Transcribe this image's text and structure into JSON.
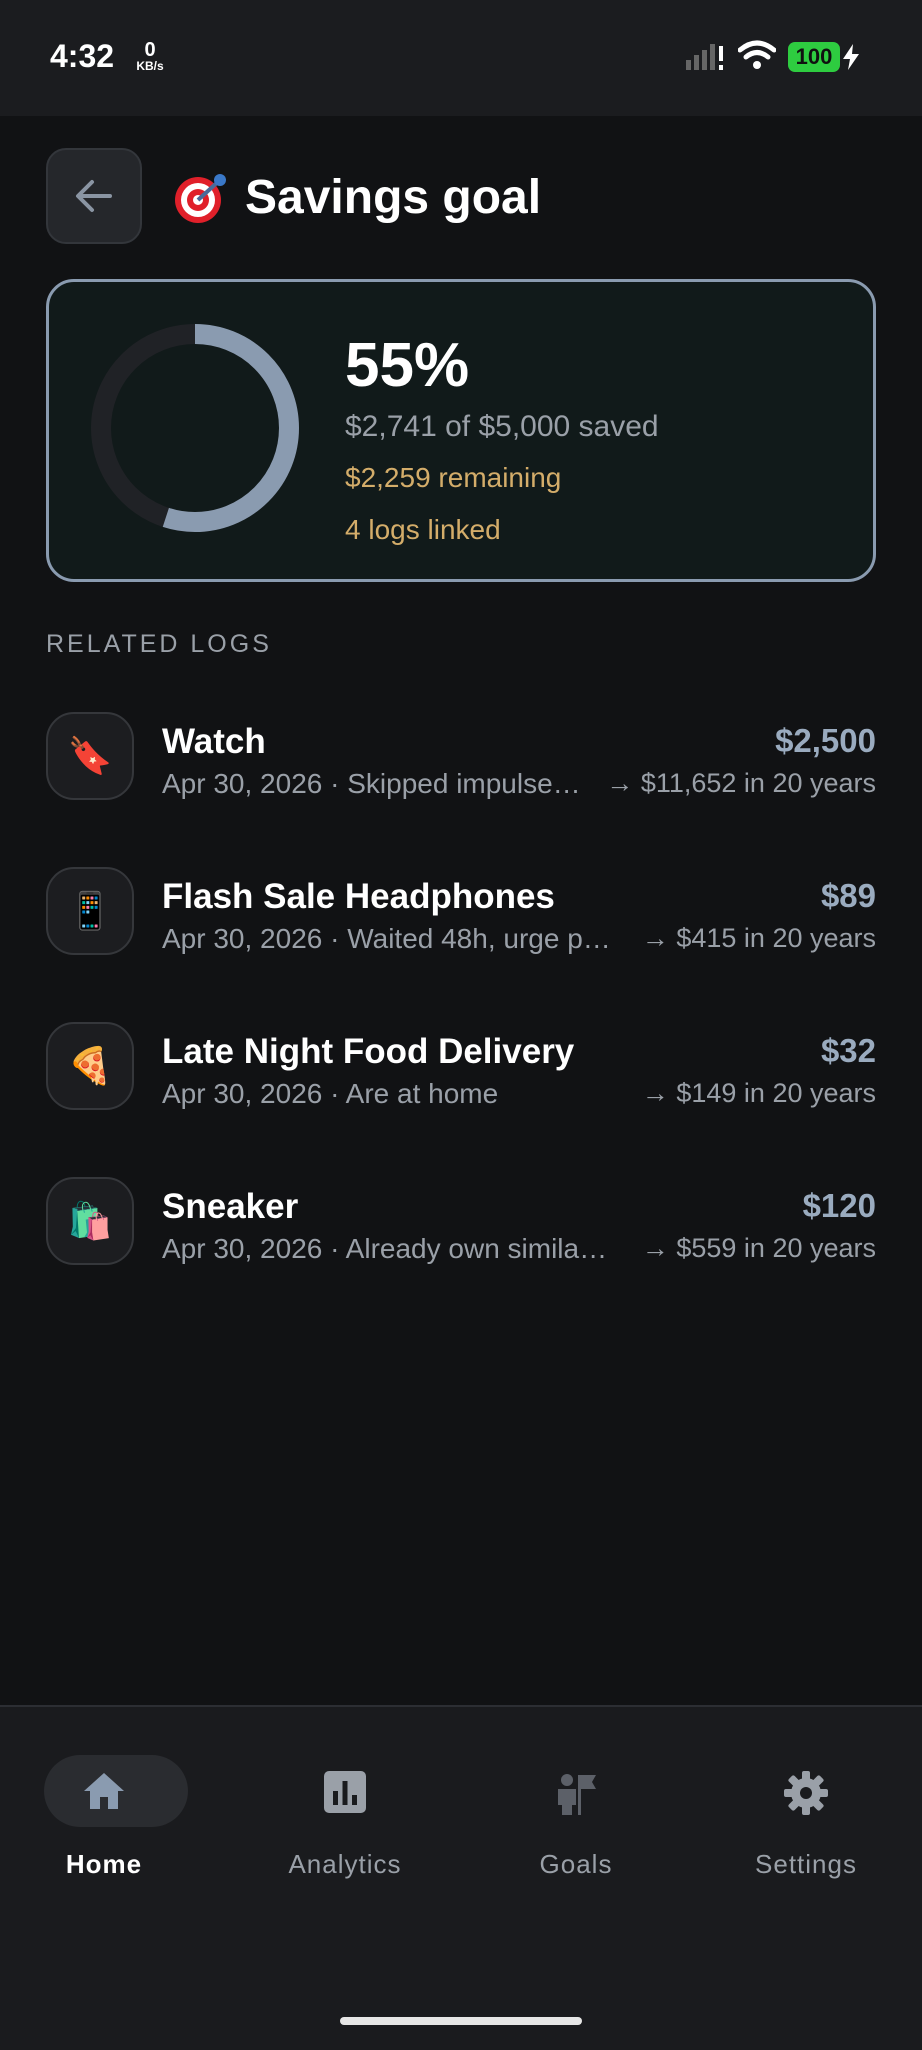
{
  "status": {
    "time": "4:32",
    "net_value": "0",
    "net_unit": "KB/s",
    "battery": "100"
  },
  "header": {
    "title": "Savings goal"
  },
  "goal": {
    "percent": "55%",
    "progress_fraction": 0.55,
    "saved_text": "$2,741 of $5,000 saved",
    "remaining_text": "$2,259 remaining",
    "logs_linked_text": "4 logs linked"
  },
  "section_label": "RELATED LOGS",
  "logs": [
    {
      "icon": "🔖",
      "icon_name": "tag-icon",
      "title": "Watch",
      "subtitle": "Apr 30, 2026  · Skipped impulse…",
      "amount": "$2,500",
      "projection": "→ $11,652 in 20 years"
    },
    {
      "icon": "📱",
      "icon_name": "phone-icon",
      "title": "Flash Sale Headphones",
      "subtitle": "Apr 30, 2026  · Waited 48h, urge p…",
      "amount": "$89",
      "projection": "→ $415 in 20 years"
    },
    {
      "icon": "🍕",
      "icon_name": "pizza-icon",
      "title": "Late Night Food Delivery",
      "subtitle": "Apr 30, 2026  · Are at home",
      "amount": "$32",
      "projection": "→ $149 in 20 years"
    },
    {
      "icon": "🛍️",
      "icon_name": "shopping-bags-icon",
      "title": "Sneaker",
      "subtitle": "Apr 30, 2026  · Already own simila…",
      "amount": "$120",
      "projection": "→ $559 in 20 years"
    }
  ],
  "nav": [
    {
      "label": "Home",
      "active": true,
      "icon": "home-icon"
    },
    {
      "label": "Analytics",
      "active": false,
      "icon": "analytics-icon"
    },
    {
      "label": "Goals",
      "active": false,
      "icon": "goals-icon"
    },
    {
      "label": "Settings",
      "active": false,
      "icon": "gear-icon"
    }
  ],
  "colors": {
    "accent": "#8a9bb0",
    "gold": "#d4ad6a",
    "background": "#111214"
  }
}
